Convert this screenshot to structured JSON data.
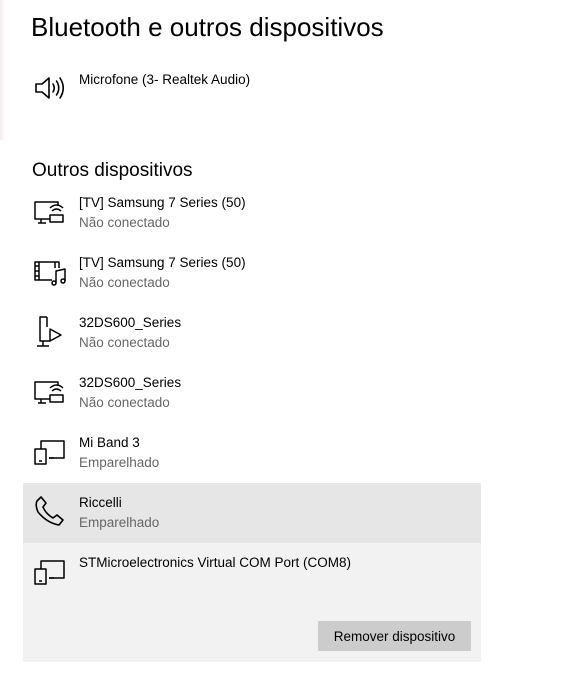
{
  "page": {
    "title": "Bluetooth e outros dispositivos"
  },
  "audio_device": {
    "name": "Microfone (3- Realtek Audio)",
    "icon": "speaker-icon"
  },
  "other_devices": {
    "heading": "Outros dispositivos",
    "items": [
      {
        "name": "[TV] Samsung 7 Series (50)",
        "status": "Não conectado",
        "icon": "display-wireless-icon"
      },
      {
        "name": "[TV] Samsung 7 Series (50)",
        "status": "Não conectado",
        "icon": "media-device-icon"
      },
      {
        "name": "32DS600_Series",
        "status": "Não conectado",
        "icon": "media-stream-icon"
      },
      {
        "name": "32DS600_Series",
        "status": "Não conectado",
        "icon": "display-wireless-icon"
      },
      {
        "name": "Mi Band 3",
        "status": "Emparelhado",
        "icon": "generic-device-icon"
      },
      {
        "name": "Riccelli",
        "status": "Emparelhado",
        "icon": "phone-icon"
      },
      {
        "name": "STMicroelectronics Virtual COM Port (COM8)",
        "status": "",
        "icon": "generic-device-icon"
      }
    ]
  },
  "actions": {
    "remove_label": "Remover dispositivo"
  },
  "colors": {
    "hover_background": "#e6e6e6",
    "selected_background": "#f2f2f2",
    "button_background": "#cccccc",
    "secondary_text": "#666666"
  }
}
